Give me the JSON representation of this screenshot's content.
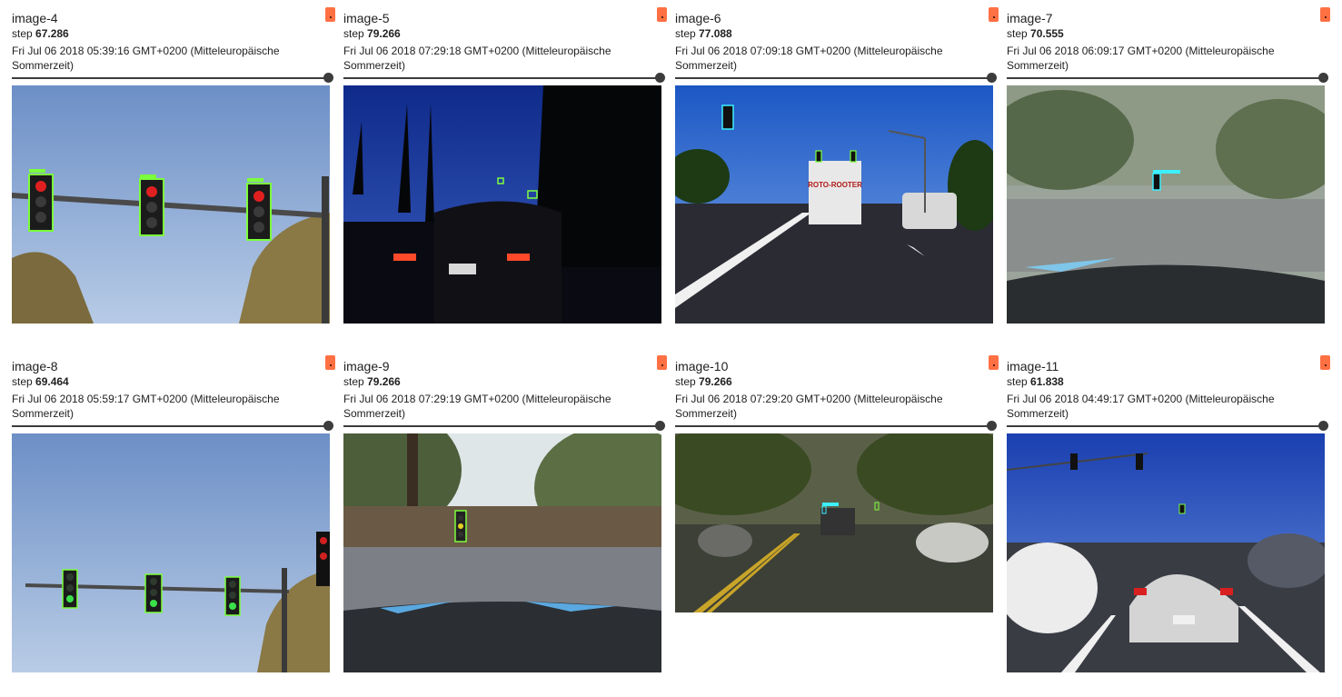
{
  "cards": [
    {
      "title": "image-4",
      "step_label": "step",
      "step_value": "67.286",
      "timestamp": "Fri Jul 06 2018 05:39:16 GMT+0200 (Mitteleuropäische Sommerzeit)"
    },
    {
      "title": "image-5",
      "step_label": "step",
      "step_value": "79.266",
      "timestamp": "Fri Jul 06 2018 07:29:18 GMT+0200 (Mitteleuropäische Sommerzeit)"
    },
    {
      "title": "image-6",
      "step_label": "step",
      "step_value": "77.088",
      "timestamp": "Fri Jul 06 2018 07:09:18 GMT+0200 (Mitteleuropäische Sommerzeit)"
    },
    {
      "title": "image-7",
      "step_label": "step",
      "step_value": "70.555",
      "timestamp": "Fri Jul 06 2018 06:09:17 GMT+0200 (Mitteleuropäische Sommerzeit)"
    },
    {
      "title": "image-8",
      "step_label": "step",
      "step_value": "69.464",
      "timestamp": "Fri Jul 06 2018 05:59:17 GMT+0200 (Mitteleuropäische Sommerzeit)"
    },
    {
      "title": "image-9",
      "step_label": "step",
      "step_value": "79.266",
      "timestamp": "Fri Jul 06 2018 07:29:19 GMT+0200 (Mitteleuropäische Sommerzeit)"
    },
    {
      "title": "image-10",
      "step_label": "step",
      "step_value": "79.266",
      "timestamp": "Fri Jul 06 2018 07:29:20 GMT+0200 (Mitteleuropäische Sommerzeit)"
    },
    {
      "title": "image-11",
      "step_label": "step",
      "step_value": "61.838",
      "timestamp": "Fri Jul 06 2018 04:49:17 GMT+0200 (Mitteleuropäische Sommerzeit)"
    }
  ],
  "colors": {
    "pin_icon": "#ff7043",
    "slider": "#3c3c3c",
    "detection_box_green": "#7cff3c",
    "detection_box_cyan": "#3cf0ff"
  },
  "truck_text": "ROTO-ROOTER"
}
